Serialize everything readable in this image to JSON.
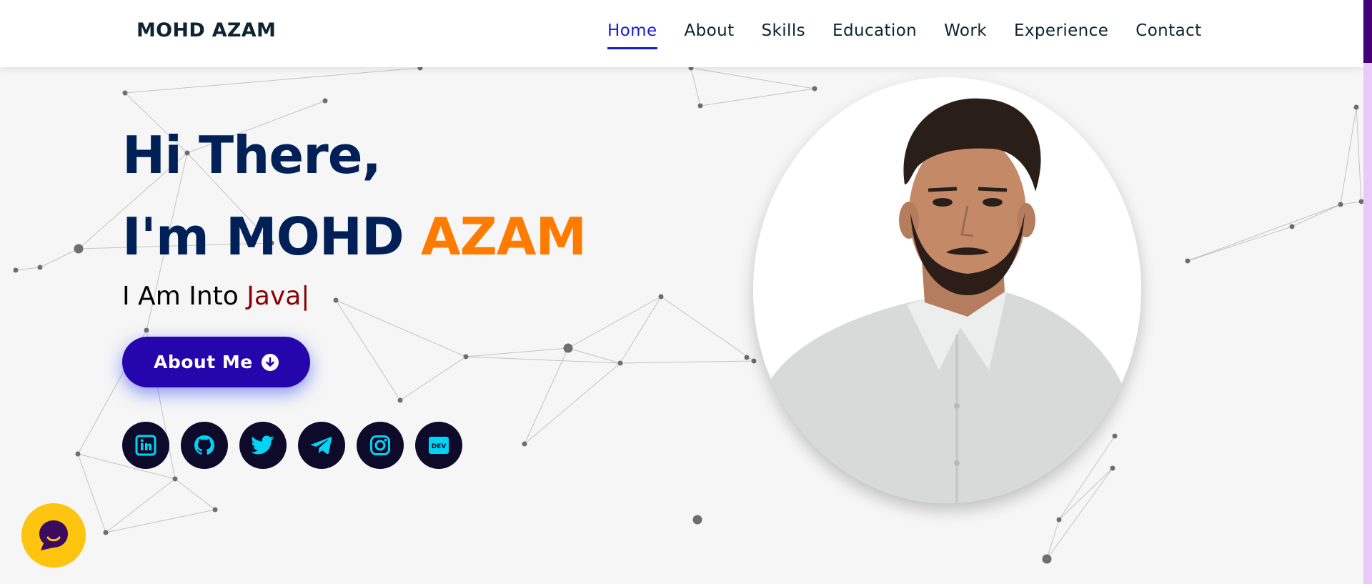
{
  "header": {
    "logo": "MOHD AZAM",
    "nav": [
      {
        "label": "Home",
        "active": true
      },
      {
        "label": "About"
      },
      {
        "label": "Skills"
      },
      {
        "label": "Education"
      },
      {
        "label": "Work"
      },
      {
        "label": "Experience"
      },
      {
        "label": "Contact"
      }
    ]
  },
  "hero": {
    "greeting": "Hi There,",
    "intro_prefix": "I'm MOHD ",
    "intro_highlight": "AZAM",
    "typing_prefix": "I Am Into ",
    "typing_word": "Java",
    "typing_cursor": "|",
    "about_button": "About Me",
    "socials": [
      {
        "icon": "linkedin-icon"
      },
      {
        "icon": "github-icon"
      },
      {
        "icon": "twitter-icon"
      },
      {
        "icon": "telegram-icon"
      },
      {
        "icon": "instagram-icon"
      },
      {
        "icon": "dev-icon",
        "text": "DEV"
      }
    ]
  },
  "colors": {
    "primary_text": "#002057",
    "accent": "#ff7b00",
    "typed": "#8b0000",
    "button": "#2506ad",
    "active_nav": "#1a1ad6",
    "social_bg": "#0e0a2a",
    "social_icon": "#00d4f5",
    "chat": "#ffc40f"
  }
}
